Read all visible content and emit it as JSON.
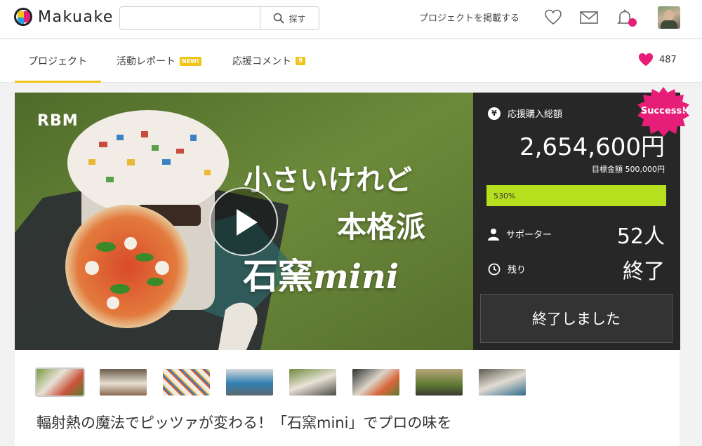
{
  "header": {
    "logo_text": "Makuake",
    "search": {
      "placeholder": "",
      "button_label": "探す"
    },
    "post_project_label": "プロジェクトを掲載する",
    "icons": [
      "heart-icon",
      "mail-icon",
      "bell-icon",
      "avatar"
    ]
  },
  "tabs": [
    {
      "label": "プロジェクト",
      "active": true
    },
    {
      "label": "活動レポート",
      "badge": "NEW!"
    },
    {
      "label": "応援コメント",
      "badge": "9"
    }
  ],
  "likes": {
    "count": "487"
  },
  "hero": {
    "logo": "RBM",
    "title_line1": "小さいけれど",
    "title_line2": "本格派",
    "title_line3_jp": "石窯",
    "title_line3_en": "mini"
  },
  "stats": {
    "success_badge": "Success!",
    "total_label": "応援購入総額",
    "total_value": "2,654,600円",
    "goal_text": "目標金額 500,000円",
    "progress_percent": 530,
    "progress_label": "530%",
    "supporters_label": "サポーター",
    "supporters_value": "52人",
    "remaining_label": "残り",
    "remaining_value": "終了",
    "ended_button": "終了しました"
  },
  "colors": {
    "brand_pink": "#e61e78",
    "brand_yellow": "#f0c419",
    "progress_green": "#b6e01e",
    "panel_dark": "#272727"
  },
  "gallery_count": 8,
  "page_title": "輻射熱の魔法でピッツァが変わる！「石窯mini」でプロの味を"
}
